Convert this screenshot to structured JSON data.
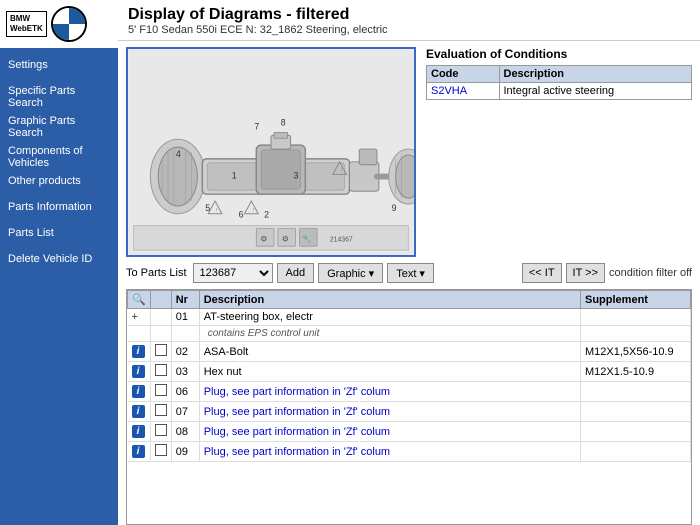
{
  "sidebar": {
    "logo": {
      "etk_text": "BMW\nWebETK",
      "bmw_alt": "BMW Logo"
    },
    "items": [
      {
        "id": "settings",
        "label": "Settings"
      },
      {
        "id": "specific-parts-search",
        "label": "Specific Parts Search"
      },
      {
        "id": "graphic-parts-search",
        "label": "Graphic Parts Search"
      },
      {
        "id": "components-of-vehicles",
        "label": "Components of Vehicles"
      },
      {
        "id": "other-products",
        "label": "Other products"
      },
      {
        "id": "parts-information",
        "label": "Parts Information"
      },
      {
        "id": "parts-list",
        "label": "Parts List"
      },
      {
        "id": "delete-vehicle-id",
        "label": "Delete Vehicle ID"
      }
    ]
  },
  "header": {
    "title": "Display of Diagrams - filtered",
    "subtitle": "5' F10 Sedan 550i ECE N: 32_1862 Steering, electric"
  },
  "evaluation": {
    "title": "Evaluation of Conditions",
    "columns": [
      "Code",
      "Description"
    ],
    "rows": [
      {
        "code": "S2VHA",
        "description": "Integral active steering"
      }
    ]
  },
  "toolbar": {
    "parts_list_label": "To Parts List",
    "parts_list_value": "123687",
    "add_label": "Add",
    "graphic_label": "Graphic ▾",
    "text_label": "Text ▾",
    "nav_prev": "<< IT",
    "nav_next": "IT >>",
    "condition_label": "condition filter off"
  },
  "parts_table": {
    "columns": [
      "",
      "",
      "Nr",
      "Description",
      "Supplement"
    ],
    "rows": [
      {
        "info": false,
        "check": false,
        "plus": true,
        "nr": "01",
        "description": "AT-steering box, electr",
        "supplement": "",
        "is_sub": false,
        "is_link": false
      },
      {
        "info": false,
        "check": false,
        "plus": false,
        "nr": "",
        "description": "contains EPS control unit",
        "supplement": "",
        "is_sub": true,
        "is_link": false
      },
      {
        "info": true,
        "check": true,
        "plus": false,
        "nr": "02",
        "description": "ASA-Bolt",
        "supplement": "M12X1,5X56-10.9",
        "is_sub": false,
        "is_link": false
      },
      {
        "info": true,
        "check": true,
        "plus": false,
        "nr": "03",
        "description": "Hex nut",
        "supplement": "M12X1.5-10.9",
        "is_sub": false,
        "is_link": false
      },
      {
        "info": true,
        "check": true,
        "plus": false,
        "nr": "06",
        "description": "Plug, see part information in 'Zf' colum",
        "supplement": "",
        "is_sub": false,
        "is_link": true
      },
      {
        "info": true,
        "check": true,
        "plus": false,
        "nr": "07",
        "description": "Plug, see part information in 'Zf' colum",
        "supplement": "",
        "is_sub": false,
        "is_link": true
      },
      {
        "info": true,
        "check": true,
        "plus": false,
        "nr": "08",
        "description": "Plug, see part information in 'Zf' colum",
        "supplement": "",
        "is_sub": false,
        "is_link": true
      },
      {
        "info": true,
        "check": true,
        "plus": false,
        "nr": "09",
        "description": "Plug, see part information in 'Zf' colum",
        "supplement": "",
        "is_sub": false,
        "is_link": true
      }
    ]
  }
}
